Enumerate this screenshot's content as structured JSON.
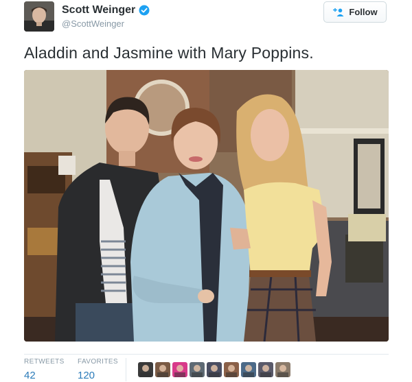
{
  "author": {
    "name": "Scott Weinger",
    "handle": "@ScottWeinger",
    "verified": true,
    "verified_icon": "verified-badge-icon"
  },
  "follow_button": {
    "label": "Follow",
    "icon": "add-person-icon"
  },
  "tweet": {
    "text": "Aladdin and Jasmine with Mary Poppins."
  },
  "stats": {
    "retweets_label": "RETWEETS",
    "retweets_value": "42",
    "favorites_label": "FAVORITES",
    "favorites_value": "120"
  },
  "favoriter_avatar_colors": [
    "#3a3a3a",
    "#7a5a44",
    "#d83a8a",
    "#5e6a74",
    "#4a4e62",
    "#8a6048",
    "#4c6a88",
    "#5a5a6a",
    "#8a7a6a"
  ],
  "colors": {
    "link_blue": "#2b7bb9",
    "verified_blue": "#1da1f2",
    "muted_gray": "#8899a6"
  }
}
